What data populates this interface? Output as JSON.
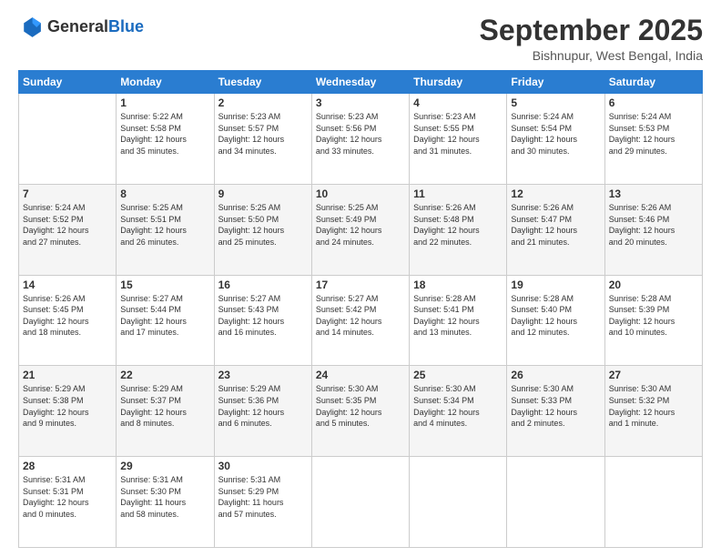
{
  "header": {
    "logo_general": "General",
    "logo_blue": "Blue",
    "month_title": "September 2025",
    "location": "Bishnupur, West Bengal, India"
  },
  "days_of_week": [
    "Sunday",
    "Monday",
    "Tuesday",
    "Wednesday",
    "Thursday",
    "Friday",
    "Saturday"
  ],
  "weeks": [
    [
      {
        "day": "",
        "content": ""
      },
      {
        "day": "1",
        "content": "Sunrise: 5:22 AM\nSunset: 5:58 PM\nDaylight: 12 hours\nand 35 minutes."
      },
      {
        "day": "2",
        "content": "Sunrise: 5:23 AM\nSunset: 5:57 PM\nDaylight: 12 hours\nand 34 minutes."
      },
      {
        "day": "3",
        "content": "Sunrise: 5:23 AM\nSunset: 5:56 PM\nDaylight: 12 hours\nand 33 minutes."
      },
      {
        "day": "4",
        "content": "Sunrise: 5:23 AM\nSunset: 5:55 PM\nDaylight: 12 hours\nand 31 minutes."
      },
      {
        "day": "5",
        "content": "Sunrise: 5:24 AM\nSunset: 5:54 PM\nDaylight: 12 hours\nand 30 minutes."
      },
      {
        "day": "6",
        "content": "Sunrise: 5:24 AM\nSunset: 5:53 PM\nDaylight: 12 hours\nand 29 minutes."
      }
    ],
    [
      {
        "day": "7",
        "content": "Sunrise: 5:24 AM\nSunset: 5:52 PM\nDaylight: 12 hours\nand 27 minutes."
      },
      {
        "day": "8",
        "content": "Sunrise: 5:25 AM\nSunset: 5:51 PM\nDaylight: 12 hours\nand 26 minutes."
      },
      {
        "day": "9",
        "content": "Sunrise: 5:25 AM\nSunset: 5:50 PM\nDaylight: 12 hours\nand 25 minutes."
      },
      {
        "day": "10",
        "content": "Sunrise: 5:25 AM\nSunset: 5:49 PM\nDaylight: 12 hours\nand 24 minutes."
      },
      {
        "day": "11",
        "content": "Sunrise: 5:26 AM\nSunset: 5:48 PM\nDaylight: 12 hours\nand 22 minutes."
      },
      {
        "day": "12",
        "content": "Sunrise: 5:26 AM\nSunset: 5:47 PM\nDaylight: 12 hours\nand 21 minutes."
      },
      {
        "day": "13",
        "content": "Sunrise: 5:26 AM\nSunset: 5:46 PM\nDaylight: 12 hours\nand 20 minutes."
      }
    ],
    [
      {
        "day": "14",
        "content": "Sunrise: 5:26 AM\nSunset: 5:45 PM\nDaylight: 12 hours\nand 18 minutes."
      },
      {
        "day": "15",
        "content": "Sunrise: 5:27 AM\nSunset: 5:44 PM\nDaylight: 12 hours\nand 17 minutes."
      },
      {
        "day": "16",
        "content": "Sunrise: 5:27 AM\nSunset: 5:43 PM\nDaylight: 12 hours\nand 16 minutes."
      },
      {
        "day": "17",
        "content": "Sunrise: 5:27 AM\nSunset: 5:42 PM\nDaylight: 12 hours\nand 14 minutes."
      },
      {
        "day": "18",
        "content": "Sunrise: 5:28 AM\nSunset: 5:41 PM\nDaylight: 12 hours\nand 13 minutes."
      },
      {
        "day": "19",
        "content": "Sunrise: 5:28 AM\nSunset: 5:40 PM\nDaylight: 12 hours\nand 12 minutes."
      },
      {
        "day": "20",
        "content": "Sunrise: 5:28 AM\nSunset: 5:39 PM\nDaylight: 12 hours\nand 10 minutes."
      }
    ],
    [
      {
        "day": "21",
        "content": "Sunrise: 5:29 AM\nSunset: 5:38 PM\nDaylight: 12 hours\nand 9 minutes."
      },
      {
        "day": "22",
        "content": "Sunrise: 5:29 AM\nSunset: 5:37 PM\nDaylight: 12 hours\nand 8 minutes."
      },
      {
        "day": "23",
        "content": "Sunrise: 5:29 AM\nSunset: 5:36 PM\nDaylight: 12 hours\nand 6 minutes."
      },
      {
        "day": "24",
        "content": "Sunrise: 5:30 AM\nSunset: 5:35 PM\nDaylight: 12 hours\nand 5 minutes."
      },
      {
        "day": "25",
        "content": "Sunrise: 5:30 AM\nSunset: 5:34 PM\nDaylight: 12 hours\nand 4 minutes."
      },
      {
        "day": "26",
        "content": "Sunrise: 5:30 AM\nSunset: 5:33 PM\nDaylight: 12 hours\nand 2 minutes."
      },
      {
        "day": "27",
        "content": "Sunrise: 5:30 AM\nSunset: 5:32 PM\nDaylight: 12 hours\nand 1 minute."
      }
    ],
    [
      {
        "day": "28",
        "content": "Sunrise: 5:31 AM\nSunset: 5:31 PM\nDaylight: 12 hours\nand 0 minutes."
      },
      {
        "day": "29",
        "content": "Sunrise: 5:31 AM\nSunset: 5:30 PM\nDaylight: 11 hours\nand 58 minutes."
      },
      {
        "day": "30",
        "content": "Sunrise: 5:31 AM\nSunset: 5:29 PM\nDaylight: 11 hours\nand 57 minutes."
      },
      {
        "day": "",
        "content": ""
      },
      {
        "day": "",
        "content": ""
      },
      {
        "day": "",
        "content": ""
      },
      {
        "day": "",
        "content": ""
      }
    ]
  ]
}
